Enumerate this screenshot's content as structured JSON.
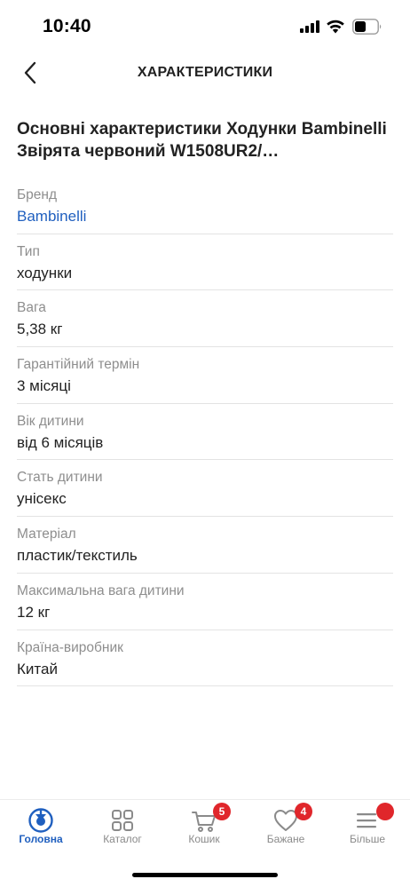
{
  "status_bar": {
    "time": "10:40",
    "icons": [
      "signal-icon",
      "wifi-icon",
      "battery-icon"
    ]
  },
  "header": {
    "title": "ХАРАКТЕРИСТИКИ",
    "back_icon": "chevron-left-icon"
  },
  "product": {
    "title": "Основні характеристики Ходунки Bambinelli Звірята червоний W1508UR2/…"
  },
  "specs": [
    {
      "label": "Бренд",
      "value": "Bambinelli",
      "link": true
    },
    {
      "label": "Тип",
      "value": "ходунки",
      "link": false
    },
    {
      "label": "Вага",
      "value": "5,38 кг",
      "link": false
    },
    {
      "label": "Гарантійний термін",
      "value": "3 місяці",
      "link": false
    },
    {
      "label": "Вік дитини",
      "value": "від 6 місяців",
      "link": false
    },
    {
      "label": "Стать дитини",
      "value": "унісекс",
      "link": false
    },
    {
      "label": "Матеріал",
      "value": "пластик/текстиль",
      "link": false
    },
    {
      "label": "Максимальна вага дитини",
      "value": "12 кг",
      "link": false
    },
    {
      "label": "Країна-виробник",
      "value": "Китай",
      "link": false
    }
  ],
  "bottom_nav": {
    "items": [
      {
        "label": "Головна",
        "icon": "home-icon",
        "active": true
      },
      {
        "label": "Каталог",
        "icon": "grid-icon",
        "active": false
      },
      {
        "label": "Кошик",
        "icon": "cart-icon",
        "active": false,
        "badge": "5"
      },
      {
        "label": "Бажане",
        "icon": "heart-icon",
        "active": false,
        "badge": "4"
      },
      {
        "label": "Більше",
        "icon": "menu-icon",
        "active": false,
        "dot": true
      }
    ]
  },
  "colors": {
    "accent": "#1f5fbf",
    "badge": "#e0262b",
    "muted": "#8e8e8e",
    "text": "#222222",
    "divider": "#e3e3e3"
  }
}
